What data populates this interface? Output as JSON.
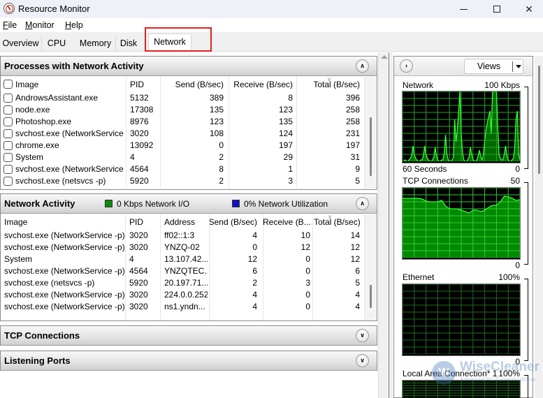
{
  "window": {
    "title": "Resource Monitor",
    "controls": {
      "minimize": "minimize",
      "maximize": "maximize",
      "close": "close"
    }
  },
  "menu": [
    {
      "label": "File",
      "mnemonic": "F",
      "rest": "ile"
    },
    {
      "label": "Monitor",
      "mnemonic": "M",
      "rest": "onitor"
    },
    {
      "label": "Help",
      "mnemonic": "H",
      "rest": "elp"
    }
  ],
  "tabs": [
    {
      "label": "Overview",
      "active": false
    },
    {
      "label": "CPU",
      "active": false
    },
    {
      "label": "Memory",
      "active": false
    },
    {
      "label": "Disk",
      "active": false
    },
    {
      "label": "Network",
      "active": true
    }
  ],
  "processes": {
    "title": "Processes with Network Activity",
    "columns": [
      "Image",
      "PID",
      "Send (B/sec)",
      "Receive (B/sec)",
      "Total (B/sec)"
    ],
    "sorted_column": "Total (B/sec)",
    "rows": [
      {
        "image": "AndrowsAssistant.exe",
        "pid": "5132",
        "send": "389",
        "receive": "8",
        "total": "396"
      },
      {
        "image": "node.exe",
        "pid": "17308",
        "send": "135",
        "receive": "123",
        "total": "258"
      },
      {
        "image": "Photoshop.exe",
        "pid": "8976",
        "send": "123",
        "receive": "135",
        "total": "258"
      },
      {
        "image": "svchost.exe (NetworkService...",
        "pid": "3020",
        "send": "108",
        "receive": "124",
        "total": "231"
      },
      {
        "image": "chrome.exe",
        "pid": "13092",
        "send": "0",
        "receive": "197",
        "total": "197"
      },
      {
        "image": "System",
        "pid": "4",
        "send": "2",
        "receive": "29",
        "total": "31"
      },
      {
        "image": "svchost.exe (NetworkService...",
        "pid": "4564",
        "send": "8",
        "receive": "1",
        "total": "9"
      },
      {
        "image": "svchost.exe (netsvcs -p)",
        "pid": "5920",
        "send": "2",
        "receive": "3",
        "total": "5"
      }
    ]
  },
  "network_activity": {
    "title": "Network Activity",
    "legend_io": "0 Kbps Network I/O",
    "legend_util": "0% Network Utilization",
    "io_color": "#0f8a0f",
    "util_color": "#1010c8",
    "columns": [
      "Image",
      "PID",
      "Address",
      "Send (B/sec)",
      "Receive (B...",
      "Total (B/sec)"
    ],
    "sorted_column": "Total (B/sec)",
    "rows": [
      {
        "image": "svchost.exe (NetworkService -p)",
        "pid": "3020",
        "address": "ff02::1:3",
        "send": "4",
        "receive": "10",
        "total": "14"
      },
      {
        "image": "svchost.exe (NetworkService -p)",
        "pid": "3020",
        "address": "YNZQ-02",
        "send": "0",
        "receive": "12",
        "total": "12"
      },
      {
        "image": "System",
        "pid": "4",
        "address": "13.107.42...",
        "send": "12",
        "receive": "0",
        "total": "12"
      },
      {
        "image": "svchost.exe (NetworkService -p)",
        "pid": "4564",
        "address": "YNZQTEC...",
        "send": "6",
        "receive": "0",
        "total": "6"
      },
      {
        "image": "svchost.exe (netsvcs -p)",
        "pid": "5920",
        "address": "20.197.71...",
        "send": "2",
        "receive": "3",
        "total": "5"
      },
      {
        "image": "svchost.exe (NetworkService -p)",
        "pid": "3020",
        "address": "224.0.0.252",
        "send": "4",
        "receive": "0",
        "total": "4"
      },
      {
        "image": "svchost.exe (NetworkService -p)",
        "pid": "3020",
        "address": "ns1.yndn...",
        "send": "4",
        "receive": "0",
        "total": "4"
      }
    ]
  },
  "tcp_connections": {
    "title": "TCP Connections"
  },
  "listening_ports": {
    "title": "Listening Ports"
  },
  "right_panel": {
    "views_label": "Views",
    "graphs": [
      {
        "title": "Network",
        "max_label": "100 Kbps",
        "min_left": "60 Seconds",
        "min_label": "0",
        "kind": "spikes",
        "values_pct": [
          0,
          0,
          2,
          0,
          0,
          2,
          4,
          8,
          22,
          10,
          4,
          2,
          0,
          0,
          2,
          2,
          8,
          22,
          10,
          4,
          2,
          0,
          0,
          2,
          6,
          20,
          8,
          2,
          0,
          0,
          2,
          2,
          12,
          38,
          10,
          2,
          0,
          0,
          2,
          6,
          60,
          28,
          45,
          72,
          100,
          40,
          12,
          2,
          0,
          0,
          2,
          6,
          20,
          10,
          3,
          0,
          0,
          2,
          8,
          16,
          6,
          2,
          10,
          30,
          45,
          55,
          64,
          72,
          40,
          100,
          100,
          100,
          100,
          50,
          10,
          4,
          2,
          2,
          10,
          22,
          8,
          2,
          0,
          0,
          2,
          4,
          20,
          60,
          72,
          10,
          2
        ]
      },
      {
        "title": "TCP Connections",
        "max_label": "50",
        "min_left": "",
        "min_label": "0",
        "kind": "area",
        "values_pct": [
          85,
          85,
          85,
          85,
          85,
          84,
          81,
          80,
          80,
          80,
          82,
          74,
          70,
          70,
          70,
          68,
          66,
          64,
          68,
          68,
          66,
          68,
          72,
          75,
          75,
          80,
          88,
          87,
          85,
          82,
          83
        ]
      },
      {
        "title": "Ethernet",
        "max_label": "100%",
        "min_left": "",
        "min_label": "0",
        "kind": "empty",
        "values_pct": []
      },
      {
        "title": "Local Area Connection* 1",
        "max_label": "100%",
        "min_left": "",
        "min_label": "",
        "kind": "empty",
        "values_pct": []
      }
    ]
  },
  "watermark": {
    "brand": "WiseCleaner",
    "tagline": "Advanced PC Tune-up Utilities",
    "logo_letter": "W"
  }
}
